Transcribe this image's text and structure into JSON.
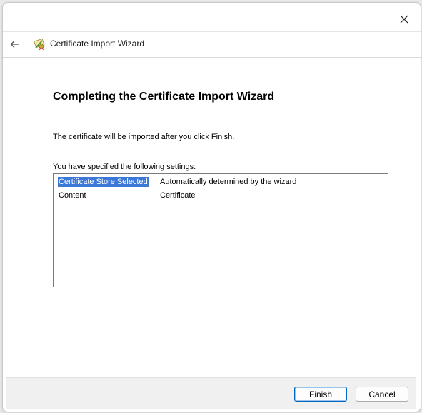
{
  "window": {
    "title": "Certificate Import Wizard",
    "close_icon": "close-icon",
    "back_icon": "back-arrow-icon",
    "app_icon": "certificate-icon"
  },
  "main": {
    "heading": "Completing the Certificate Import Wizard",
    "info_text": "The certificate will be imported after you click Finish.",
    "settings_label": "You have specified the following settings:",
    "settings": [
      {
        "key": "Certificate Store Selected",
        "value": "Automatically determined by the wizard",
        "selected": true
      },
      {
        "key": "Content",
        "value": "Certificate",
        "selected": false
      }
    ]
  },
  "footer": {
    "finish_label": "Finish",
    "cancel_label": "Cancel"
  },
  "colors": {
    "selection": "#3b78d8",
    "accent": "#0067c0"
  }
}
